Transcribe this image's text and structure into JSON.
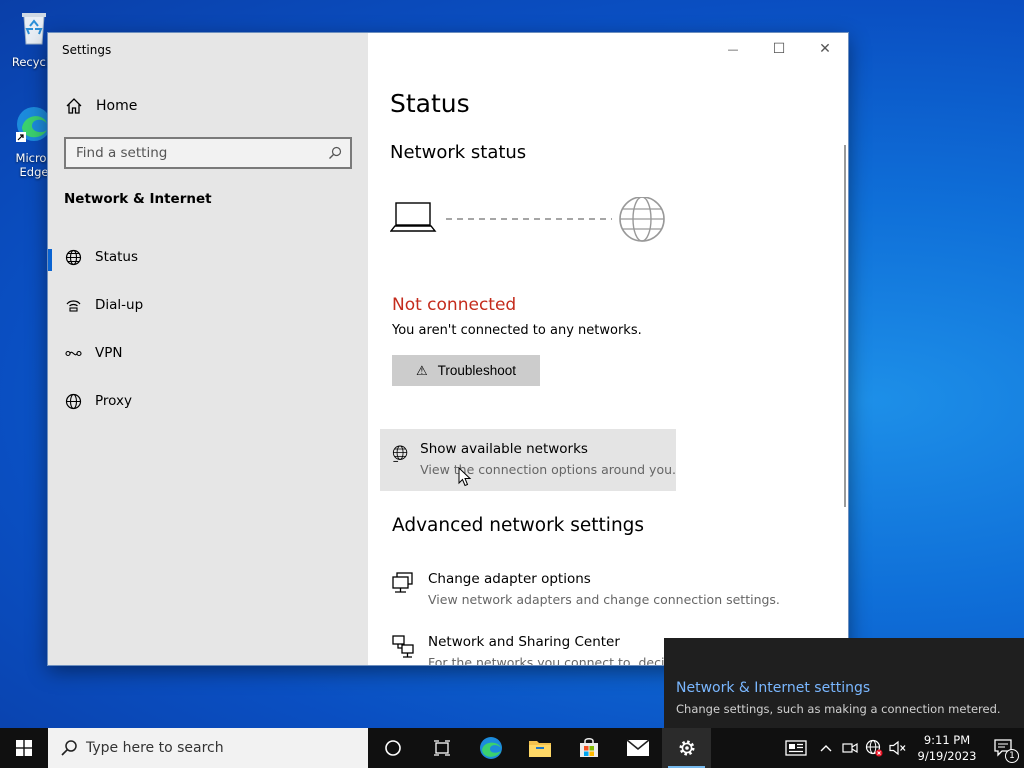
{
  "desktop": {
    "icons": [
      {
        "label": "Recycle"
      },
      {
        "label": "Micros Edge"
      }
    ]
  },
  "window": {
    "title": "Settings",
    "controls": {
      "minimize": "—",
      "maximize": "☐",
      "close": "✕"
    }
  },
  "sidebar": {
    "home": "Home",
    "search_placeholder": "Find a setting",
    "section": "Network & Internet",
    "items": [
      {
        "label": "Status",
        "icon": "globe-network-icon"
      },
      {
        "label": "Dial-up",
        "icon": "dialup-icon"
      },
      {
        "label": "VPN",
        "icon": "vpn-icon"
      },
      {
        "label": "Proxy",
        "icon": "globe-icon"
      }
    ]
  },
  "main": {
    "title": "Status",
    "network_status_heading": "Network status",
    "status_text": "Not connected",
    "status_desc": "You aren't connected to any networks.",
    "troubleshoot_label": "Troubleshoot",
    "show_networks": {
      "title": "Show available networks",
      "desc": "View the connection options around you."
    },
    "advanced_heading": "Advanced network settings",
    "adapter": {
      "title": "Change adapter options",
      "desc": "View network adapters and change connection settings."
    },
    "sharing": {
      "title": "Network and Sharing Center",
      "desc": "For the networks you connect to, decide w"
    }
  },
  "toast": {
    "title": "Network & Internet settings",
    "desc": "Change settings, such as making a connection metered."
  },
  "taskbar": {
    "search_placeholder": "Type here to search",
    "time": "9:11 PM",
    "date": "9/19/2023",
    "notification_count": "1"
  },
  "colors": {
    "accent": "#0a64d2",
    "error": "#c42b1c",
    "toast_link": "#7ab7ff"
  }
}
